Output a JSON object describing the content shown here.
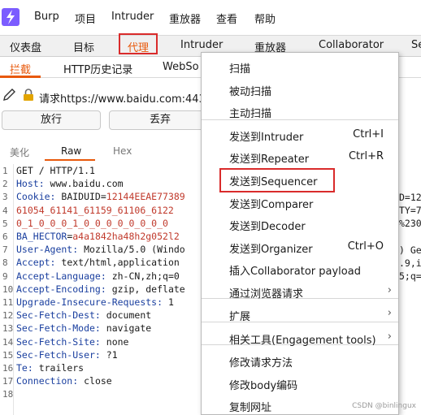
{
  "menubar": {
    "items": [
      "Burp",
      "项目",
      "Intruder",
      "重放器",
      "查看",
      "帮助"
    ]
  },
  "primary_tabs": [
    "仪表盘",
    "目标",
    "代理",
    "Intruder",
    "重放器",
    "Collaborator",
    "Se"
  ],
  "secondary_tabs": [
    "拦截",
    "HTTP历史记录",
    "WebSo"
  ],
  "request_bar": {
    "text": "请求https://www.baidu.com:443"
  },
  "buttons": {
    "forward": "放行",
    "drop": "丢弃"
  },
  "editor_tabs": [
    "美化",
    "Raw",
    "Hex"
  ],
  "code": {
    "line_numbers": [
      "1",
      "2",
      "3",
      "4",
      "5",
      "6",
      "7",
      "8",
      "9",
      "10",
      "11",
      "12",
      "13",
      "14",
      "15",
      "16",
      "17",
      "18"
    ],
    "lines": [
      {
        "pre": "",
        "key": "",
        "val": "GET / HTTP/1.1"
      },
      {
        "pre": "",
        "key": "Host:",
        "val": " www.baidu.com"
      },
      {
        "pre": "",
        "key": "Cookie:",
        "val": " BAIDUID=",
        "red": "12144EEAE77389"
      },
      {
        "pre": "",
        "key": "",
        "val": "",
        "red": "61054_61141_61159_61106_6122"
      },
      {
        "pre": "",
        "key": "",
        "val": "",
        "red": "0_1_0_0_0_1_0_0_0_0_0_0_0_0"
      },
      {
        "pre": "",
        "key": "BA_HECTOR",
        "val": "=",
        "red": "a4a1842ha48h2g052l2"
      },
      {
        "pre": "",
        "key": "User-Agent:",
        "val": " Mozilla/5.0 (Windo"
      },
      {
        "pre": "",
        "key": "Accept:",
        "val": " text/html,application"
      },
      {
        "pre": "",
        "key": "Accept-Language:",
        "val": " zh-CN,zh;q=0"
      },
      {
        "pre": "",
        "key": "Accept-Encoding:",
        "val": " gzip, deflate"
      },
      {
        "pre": "",
        "key": "Upgrade-Insecure-Requests:",
        "val": " 1"
      },
      {
        "pre": "",
        "key": "Sec-Fetch-Dest:",
        "val": " document"
      },
      {
        "pre": "",
        "key": "Sec-Fetch-Mode:",
        "val": " navigate"
      },
      {
        "pre": "",
        "key": "Sec-Fetch-Site:",
        "val": " none"
      },
      {
        "pre": "",
        "key": "Sec-Fetch-User:",
        "val": " ?1"
      },
      {
        "pre": "",
        "key": "Te:",
        "val": " trailers"
      },
      {
        "pre": "",
        "key": "Connection:",
        "val": " close"
      },
      {
        "pre": "",
        "key": "",
        "val": ""
      }
    ],
    "right_fragments": [
      "D=12",
      "TY=7",
      "%230",
      ") Gec",
      ".9,i",
      "5;q=0"
    ]
  },
  "context_menu": {
    "items": [
      {
        "label": "扫描",
        "shortcut": "",
        "submenu": false
      },
      {
        "label": "被动扫描",
        "shortcut": "",
        "submenu": false
      },
      {
        "label": "主动扫描",
        "shortcut": "",
        "submenu": false
      },
      {
        "label": "发送到Intruder",
        "shortcut": "Ctrl+I",
        "submenu": false
      },
      {
        "label": "发送到Repeater",
        "shortcut": "Ctrl+R",
        "submenu": false
      },
      {
        "label": "发送到Sequencer",
        "shortcut": "",
        "submenu": false
      },
      {
        "label": "发送到Comparer",
        "shortcut": "",
        "submenu": false
      },
      {
        "label": "发送到Decoder",
        "shortcut": "",
        "submenu": false
      },
      {
        "label": "发送到Organizer",
        "shortcut": "Ctrl+O",
        "submenu": false
      },
      {
        "label": "插入Collaborator payload",
        "shortcut": "",
        "submenu": false
      },
      {
        "label": "通过浏览器请求",
        "shortcut": "",
        "submenu": true
      },
      {
        "label": "扩展",
        "shortcut": "",
        "submenu": true
      },
      {
        "label": "相关工具(Engagement tools)",
        "shortcut": "",
        "submenu": true
      },
      {
        "label": "修改请求方法",
        "shortcut": "",
        "submenu": false
      },
      {
        "label": "修改body编码",
        "shortcut": "",
        "submenu": false
      },
      {
        "label": "复制网址",
        "shortcut": "",
        "submenu": false
      }
    ]
  },
  "watermark": "CSDN @binlingux",
  "colors": {
    "accent": "#e8590c",
    "highlight": "#d92b2b",
    "key": "#1a3f9f",
    "value_red": "#c0392b"
  }
}
